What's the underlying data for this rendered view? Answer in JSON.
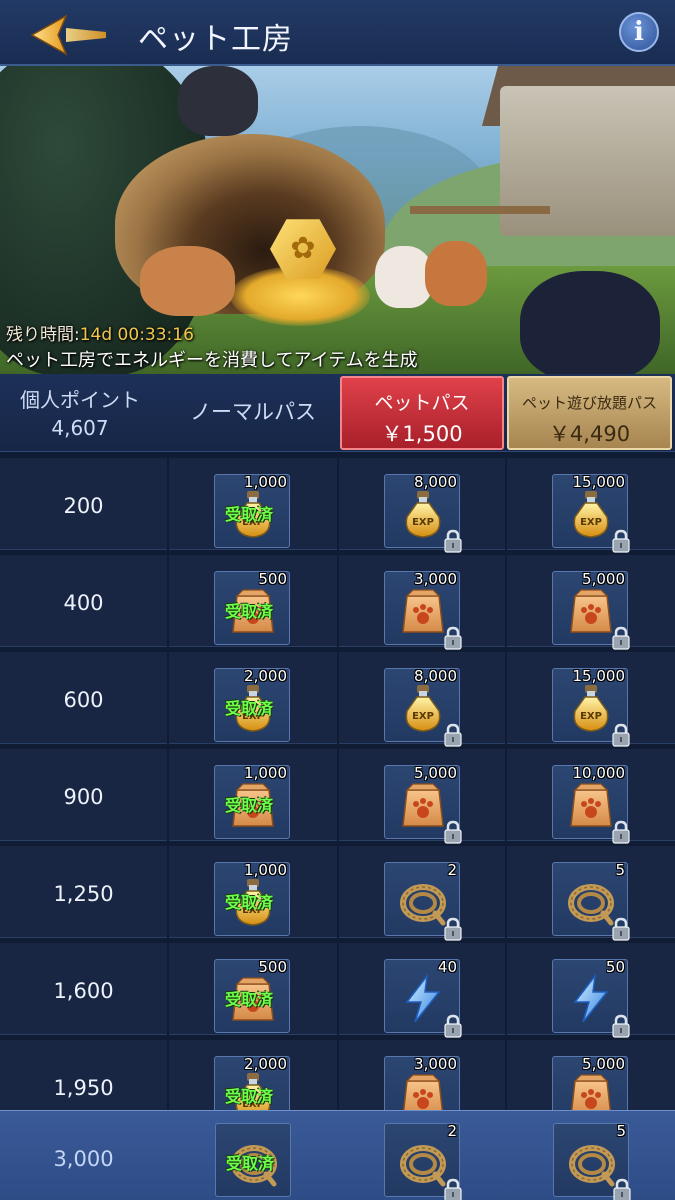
{
  "header": {
    "title": "ペット工房"
  },
  "banner": {
    "timer_label": "残り時間:",
    "timer_value": "14d 00:33:16",
    "description": "ペット工房でエネルギーを消費してアイテムを生成"
  },
  "columns": {
    "points_label": "個人ポイント",
    "points_value": "4,607",
    "normal_pass": "ノーマルパス",
    "pet_pass": {
      "name": "ペットパス",
      "price": "￥1,500"
    },
    "unlimited_pass": {
      "name": "ペット遊び放題パス",
      "price": "￥4,490"
    }
  },
  "claimed_label": "受取済",
  "colors": {
    "pet_pass": "#c22b34",
    "unlimited_pass": "#c4a26a",
    "claimed": "#6dff4a"
  },
  "rows": [
    {
      "points": "200",
      "normal": {
        "icon": "exp-potion-icon",
        "qty": "1,000",
        "claimed": true
      },
      "pet": {
        "icon": "exp-potion-icon",
        "qty": "8,000"
      },
      "unlimited": {
        "icon": "exp-potion-icon",
        "qty": "15,000"
      }
    },
    {
      "points": "400",
      "normal": {
        "icon": "pet-food-bag-icon",
        "qty": "500",
        "claimed": true
      },
      "pet": {
        "icon": "pet-food-bag-icon",
        "qty": "3,000"
      },
      "unlimited": {
        "icon": "pet-food-bag-icon",
        "qty": "5,000"
      }
    },
    {
      "points": "600",
      "normal": {
        "icon": "exp-potion-icon",
        "qty": "2,000",
        "claimed": true
      },
      "pet": {
        "icon": "exp-potion-icon",
        "qty": "8,000"
      },
      "unlimited": {
        "icon": "exp-potion-icon",
        "qty": "15,000"
      }
    },
    {
      "points": "900",
      "normal": {
        "icon": "pet-food-bag-icon",
        "qty": "1,000",
        "claimed": true
      },
      "pet": {
        "icon": "pet-food-bag-icon",
        "qty": "5,000"
      },
      "unlimited": {
        "icon": "pet-food-bag-icon",
        "qty": "10,000"
      }
    },
    {
      "points": "1,250",
      "normal": {
        "icon": "exp-potion-icon",
        "qty": "1,000",
        "claimed": true
      },
      "pet": {
        "icon": "rope-icon",
        "qty": "2"
      },
      "unlimited": {
        "icon": "rope-icon",
        "qty": "5"
      }
    },
    {
      "points": "1,600",
      "normal": {
        "icon": "pet-food-bag-icon",
        "qty": "500",
        "claimed": true
      },
      "pet": {
        "icon": "lightning-icon",
        "qty": "40"
      },
      "unlimited": {
        "icon": "lightning-icon",
        "qty": "50"
      }
    },
    {
      "points": "1,950",
      "normal": {
        "icon": "exp-potion-icon",
        "qty": "2,000",
        "claimed": true
      },
      "pet": {
        "icon": "pet-food-bag-icon",
        "qty": "3,000"
      },
      "unlimited": {
        "icon": "pet-food-bag-icon",
        "qty": "5,000"
      }
    }
  ],
  "bottom_row": {
    "points": "3,000",
    "normal": {
      "icon": "rope-icon",
      "qty": "",
      "claimed": true
    },
    "pet": {
      "icon": "rope-icon",
      "qty": "2"
    },
    "unlimited": {
      "icon": "rope-icon",
      "qty": "5"
    }
  }
}
